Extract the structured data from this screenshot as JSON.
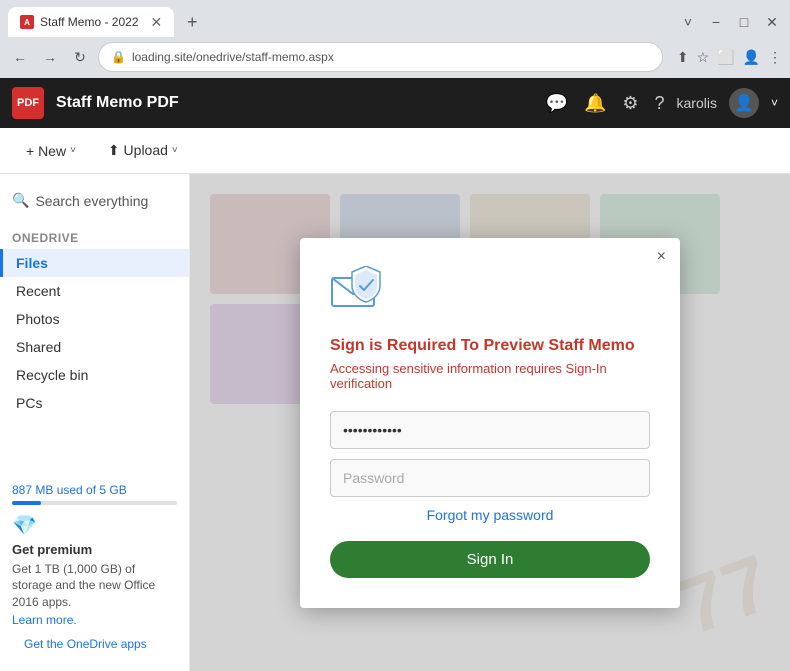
{
  "browser": {
    "tab_title": "Staff Memo - 2022",
    "tab_favicon": "A",
    "new_tab_icon": "+",
    "window_minimize": "−",
    "window_maximize": "□",
    "window_close": "✕",
    "window_chevron_up": "˅",
    "nav_back": "←",
    "nav_forward": "→",
    "nav_refresh": "↻",
    "url": "loading.site/onedrive/staff-memo.aspx",
    "addr_icons": [
      "⬆",
      "☆",
      "⬜",
      "👤",
      "⋮"
    ]
  },
  "app": {
    "logo_text": "PDF",
    "title": "Staff Memo PDF",
    "header_icons": [
      "💬",
      "🔔",
      "⚙",
      "?"
    ],
    "user_name": "karolis",
    "sidebar_chevron": "˅"
  },
  "toolbar": {
    "new_label": "+ New",
    "new_chevron": "˅",
    "upload_label": "⬆ Upload",
    "upload_chevron": "˅"
  },
  "sidebar": {
    "search_placeholder": "Search everything",
    "section": "OneDrive",
    "items": [
      {
        "label": "Files",
        "active": true
      },
      {
        "label": "Recent",
        "active": false
      },
      {
        "label": "Photos",
        "active": false
      },
      {
        "label": "Shared",
        "active": false
      },
      {
        "label": "Recycle bin",
        "active": false
      },
      {
        "label": "PCs",
        "active": false
      }
    ],
    "storage_text": "887 MB used of 5 GB",
    "get_premium_title": "Get premium",
    "get_premium_desc": "Get 1 TB (1,000 GB) of storage and the new Office 2016 apps.",
    "learn_more": "Learn more.",
    "get_apps": "Get the OneDrive apps"
  },
  "modal": {
    "close_label": "×",
    "title": "Sign is Required To Preview Staff Memo",
    "subtitle": "Accessing sensitive information requires Sign-In verification",
    "email_placeholder": "••••••••••••",
    "email_value": "••••••••••••",
    "password_placeholder": "Password",
    "forgot_label": "Forgot my password",
    "signin_label": "Sign In"
  }
}
